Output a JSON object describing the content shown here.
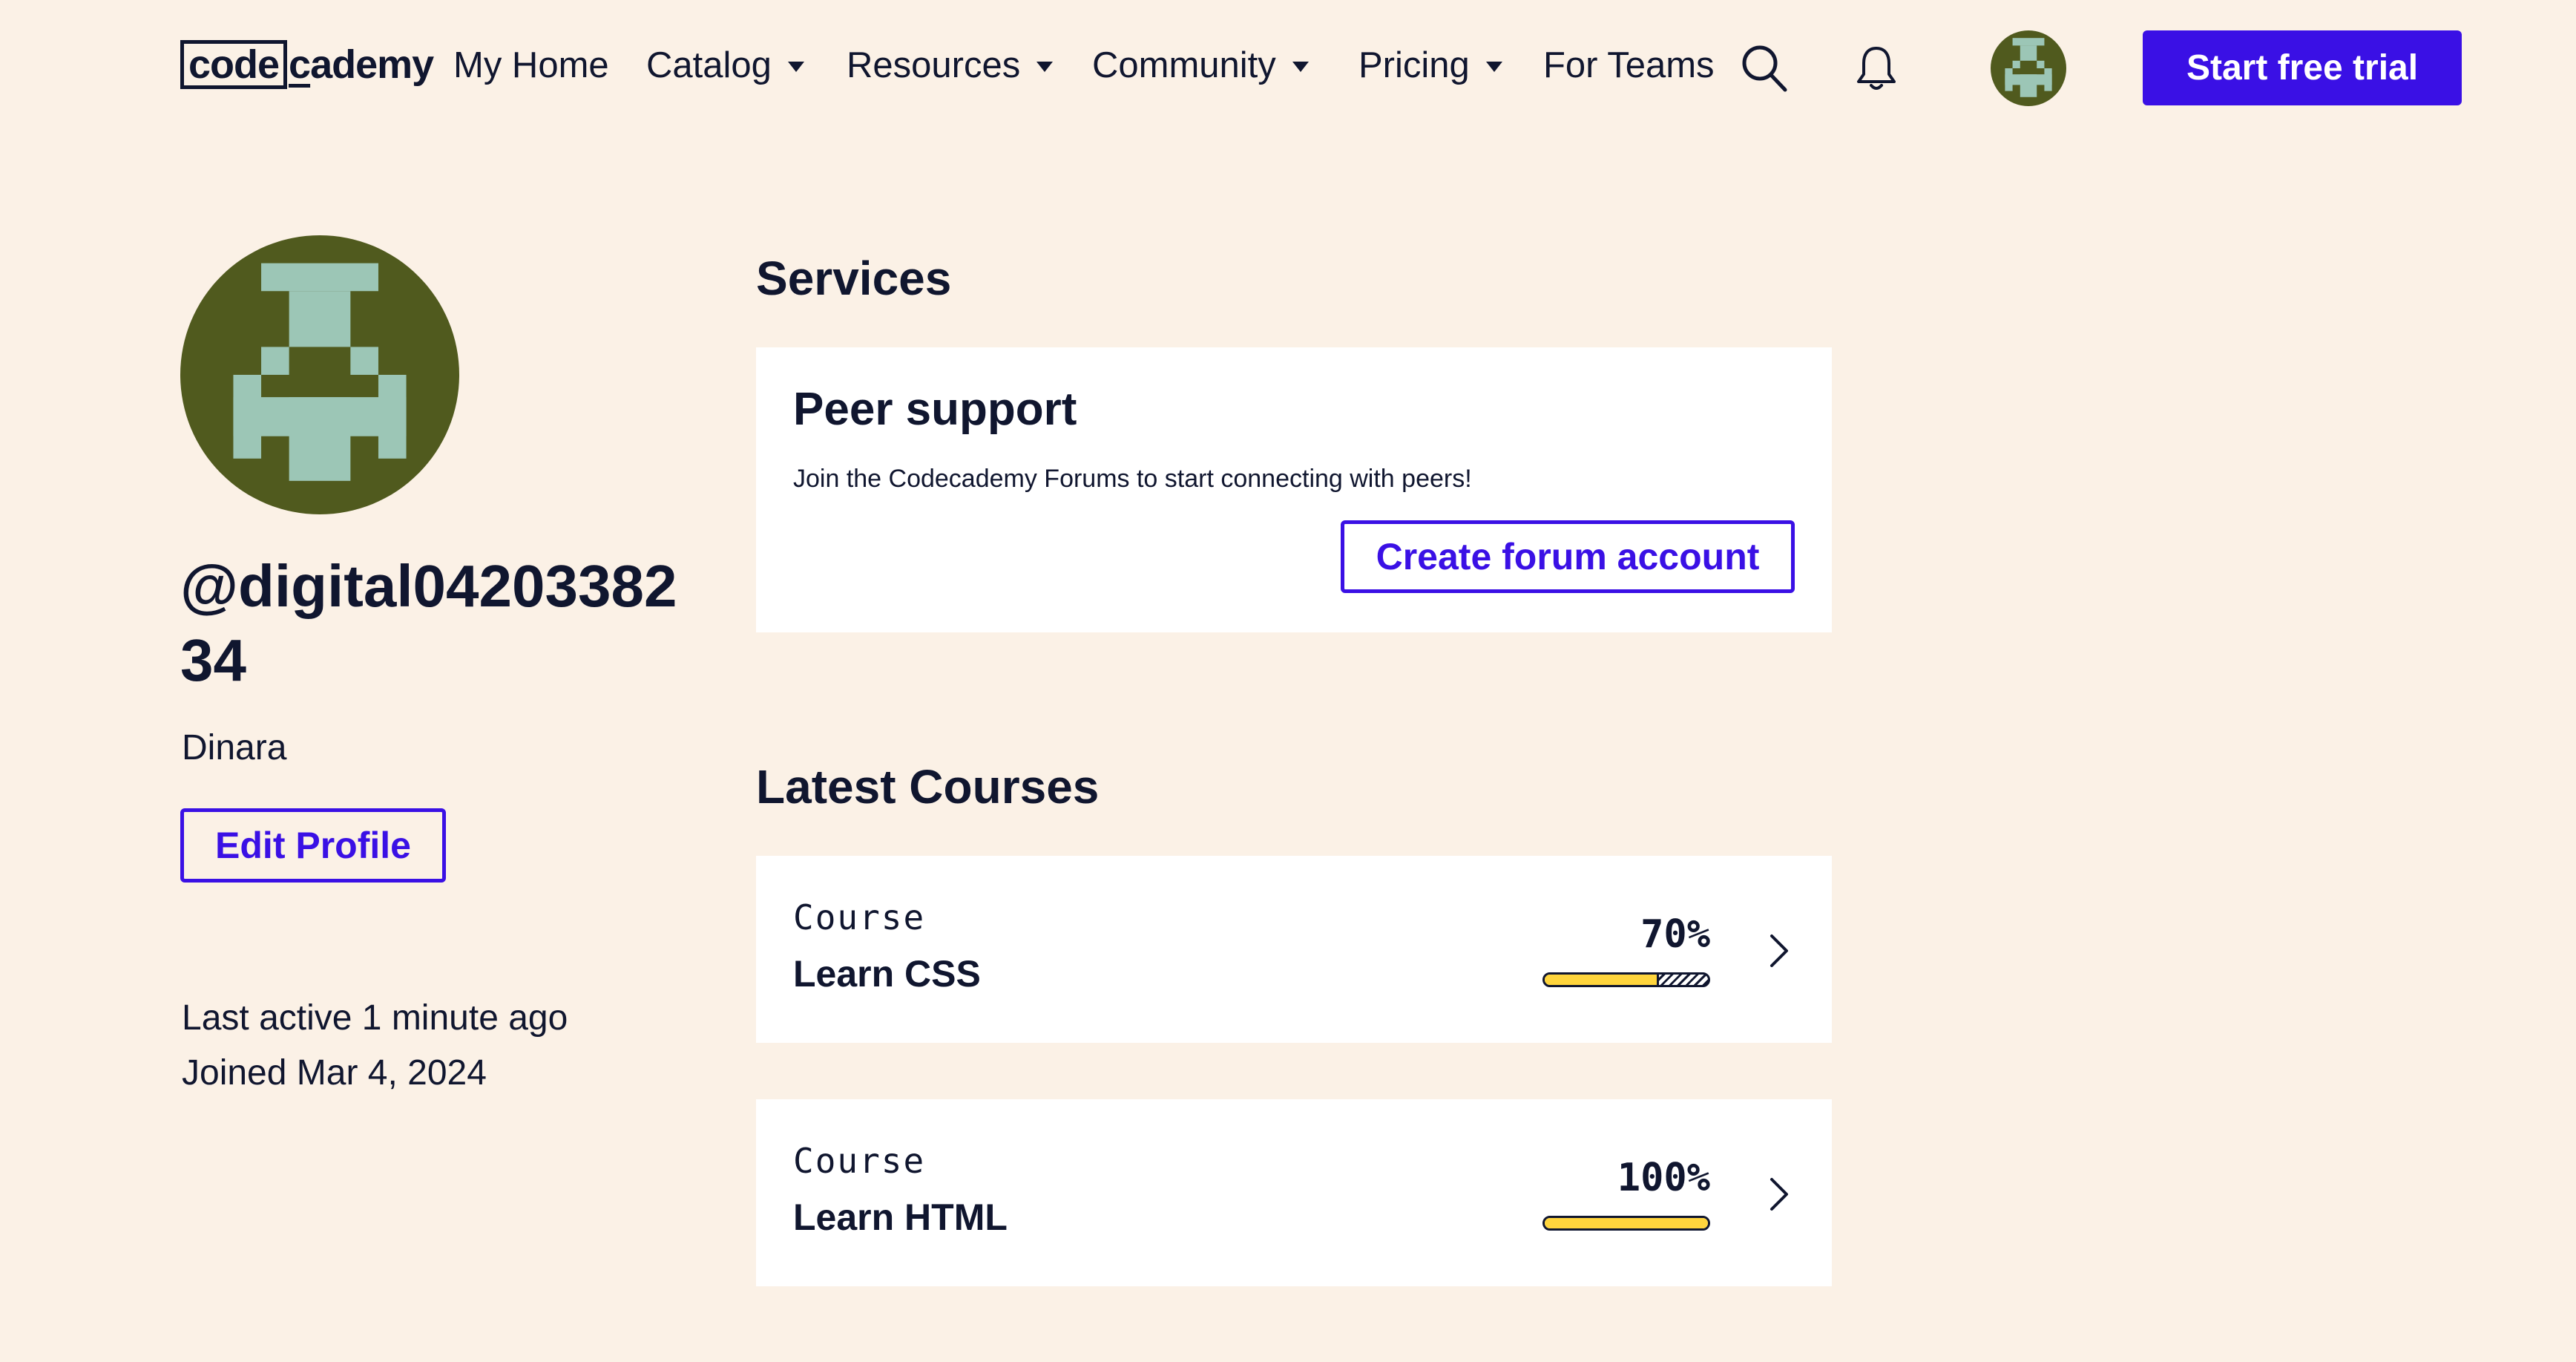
{
  "header": {
    "logo_code": "code",
    "logo_rest_underlined": "c",
    "logo_rest": "ademy",
    "nav": [
      {
        "label": "My Home",
        "has_caret": false
      },
      {
        "label": "Catalog",
        "has_caret": true
      },
      {
        "label": "Resources",
        "has_caret": true
      },
      {
        "label": "Community",
        "has_caret": true
      },
      {
        "label": "Pricing",
        "has_caret": true
      },
      {
        "label": "For Teams",
        "has_caret": false
      }
    ],
    "search_icon": "search-icon",
    "bell_icon": "bell-icon",
    "trial_button": "Start free trial"
  },
  "profile": {
    "username": "@digital0420338234",
    "real_name": "Dinara",
    "edit_button": "Edit Profile",
    "last_active": "Last active 1 minute ago",
    "joined": "Joined Mar 4, 2024",
    "avatar_colors": {
      "background": "#505a1e",
      "figure": "#9cc6b6"
    }
  },
  "services": {
    "title": "Services",
    "card_title": "Peer support",
    "description": "Join the Codecademy Forums to start connecting with peers!",
    "button": "Create forum account"
  },
  "courses": {
    "title": "Latest Courses",
    "items": [
      {
        "type": "Course",
        "name": "Learn CSS",
        "percent_label": "70%",
        "progress": 0.7
      },
      {
        "type": "Course",
        "name": "Learn HTML",
        "percent_label": "100%",
        "progress": 1.0
      }
    ]
  },
  "colors": {
    "accent": "#3a10e5",
    "page_background": "#fbf1e6",
    "text": "#10162f",
    "progress_fill": "#ffd53d"
  }
}
